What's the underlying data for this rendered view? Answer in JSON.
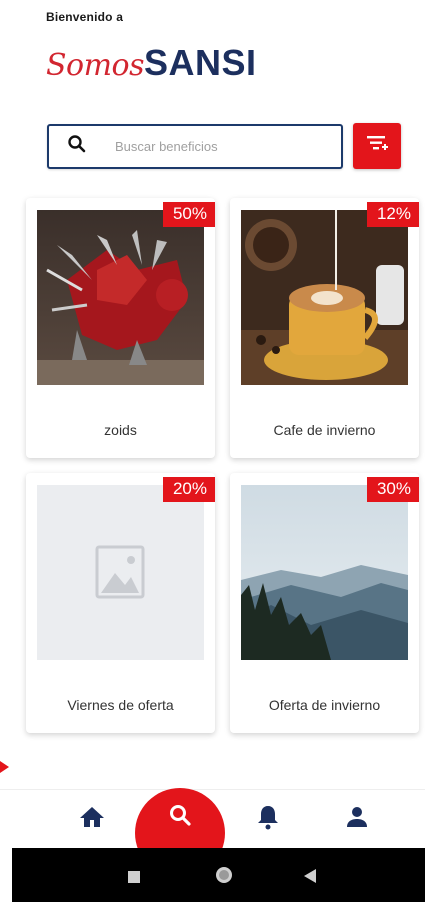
{
  "header": {
    "welcome": "Bienvenido a",
    "brand_script": "Somos",
    "brand_bold": "SANSI"
  },
  "search": {
    "placeholder": "Buscar beneficios"
  },
  "cards": [
    {
      "title": "zoids",
      "discount": "50%",
      "image": "zoids-toy-photo"
    },
    {
      "title": "Cafe de invierno",
      "discount": "12%",
      "image": "latte-coffee-photo"
    },
    {
      "title": "Viernes de oferta",
      "discount": "20%",
      "image": "placeholder-image-icon"
    },
    {
      "title": "Oferta de invierno",
      "discount": "30%",
      "image": "mountain-landscape-photo"
    }
  ],
  "nav": [
    {
      "name": "home",
      "icon": "home-icon"
    },
    {
      "name": "search",
      "icon": "search-icon",
      "active": true
    },
    {
      "name": "notifications",
      "icon": "bell-icon"
    },
    {
      "name": "profile",
      "icon": "user-icon"
    }
  ],
  "colors": {
    "accent": "#e3151b",
    "brand_navy": "#1c2f5e"
  }
}
